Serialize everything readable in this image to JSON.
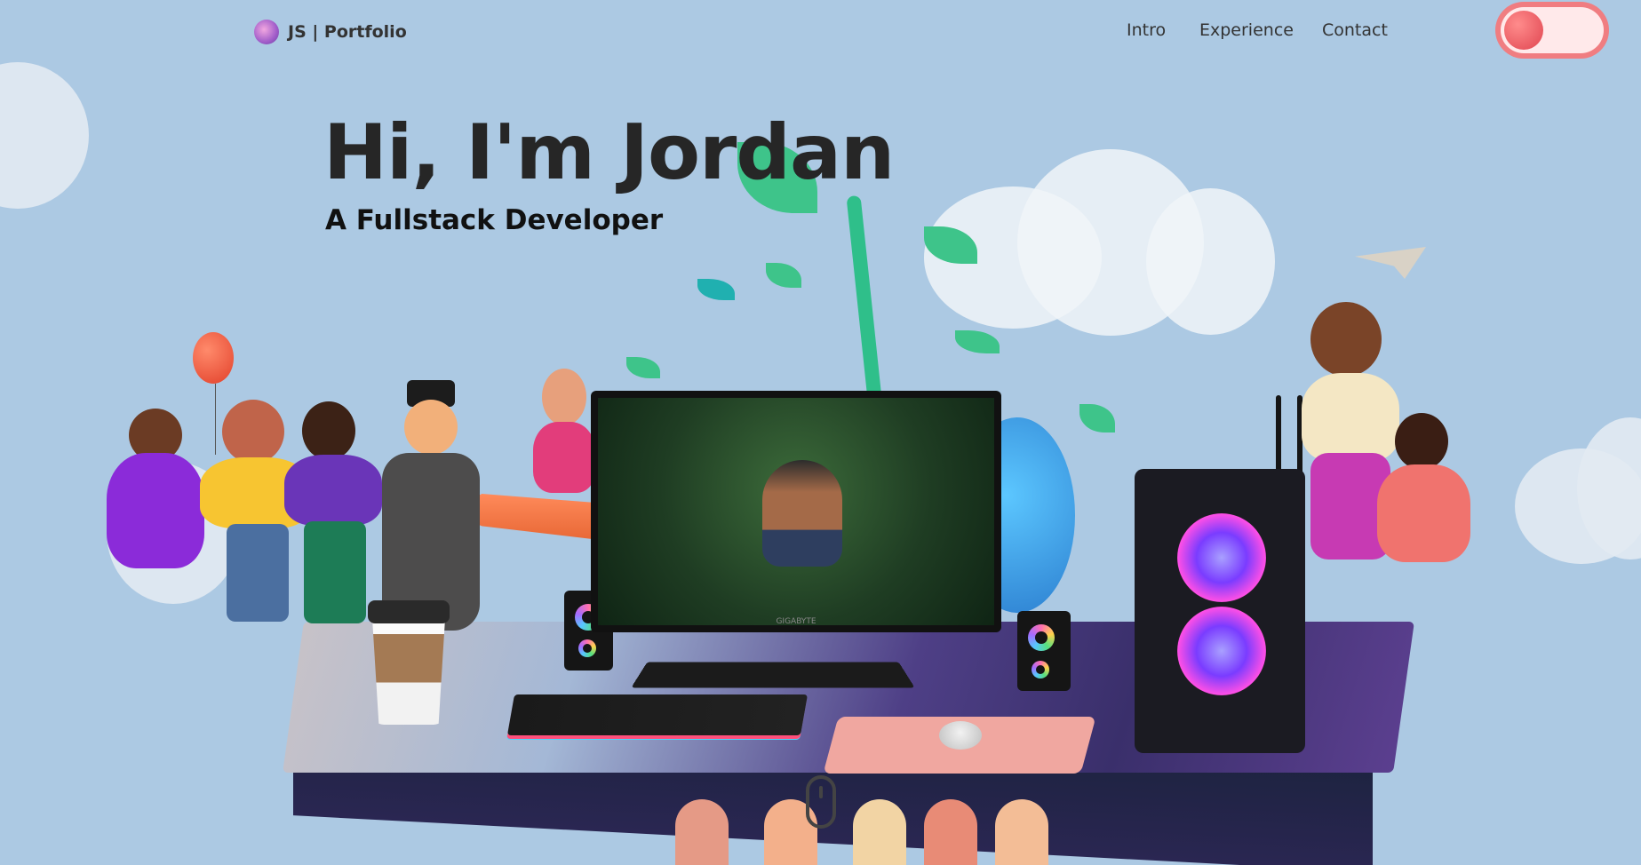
{
  "header": {
    "logo_text": "JS | Portfolio",
    "nav": [
      "Intro",
      "Experience",
      "Contact"
    ],
    "theme_toggle_state": "light"
  },
  "hero": {
    "title": "Hi, I'm Jordan",
    "subtitle": "A Fullstack Developer"
  },
  "monitor": {
    "brand": "GIGABYTE"
  },
  "colors": {
    "background": "#acc9e3",
    "toggle": "#f07d81",
    "text": "#262626"
  },
  "icons": {
    "logo": "logo-orb-icon",
    "scroll": "scroll-mouse-icon"
  }
}
